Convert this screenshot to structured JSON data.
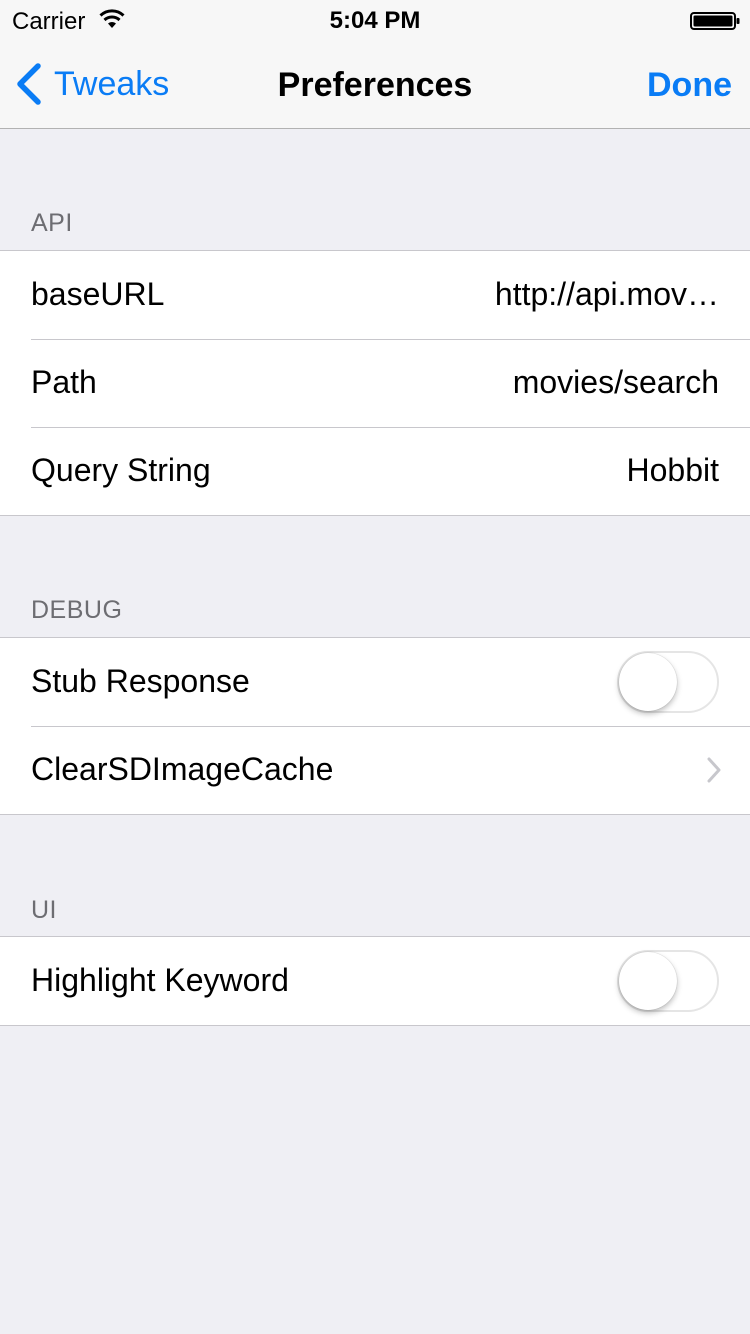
{
  "status_bar": {
    "carrier": "Carrier",
    "time": "5:04 PM"
  },
  "nav": {
    "back_label": "Tweaks",
    "title": "Preferences",
    "done_label": "Done"
  },
  "colors": {
    "accent": "#0a7cf5",
    "background": "#efeff4",
    "separator": "#c8c7cc",
    "section_header": "#6d6d72"
  },
  "sections": [
    {
      "header": "API",
      "rows": [
        {
          "label": "baseURL",
          "value": "http://api.mov…"
        },
        {
          "label": "Path",
          "value": "movies/search"
        },
        {
          "label": "Query String",
          "value": "Hobbit"
        }
      ]
    },
    {
      "header": "DEBUG",
      "rows": [
        {
          "label": "Stub Response",
          "toggle_on": false
        },
        {
          "label": "ClearSDImageCache",
          "accessory": "chevron-right-icon"
        }
      ]
    },
    {
      "header": "UI",
      "rows": [
        {
          "label": "Highlight Keyword",
          "toggle_on": false
        }
      ]
    }
  ]
}
